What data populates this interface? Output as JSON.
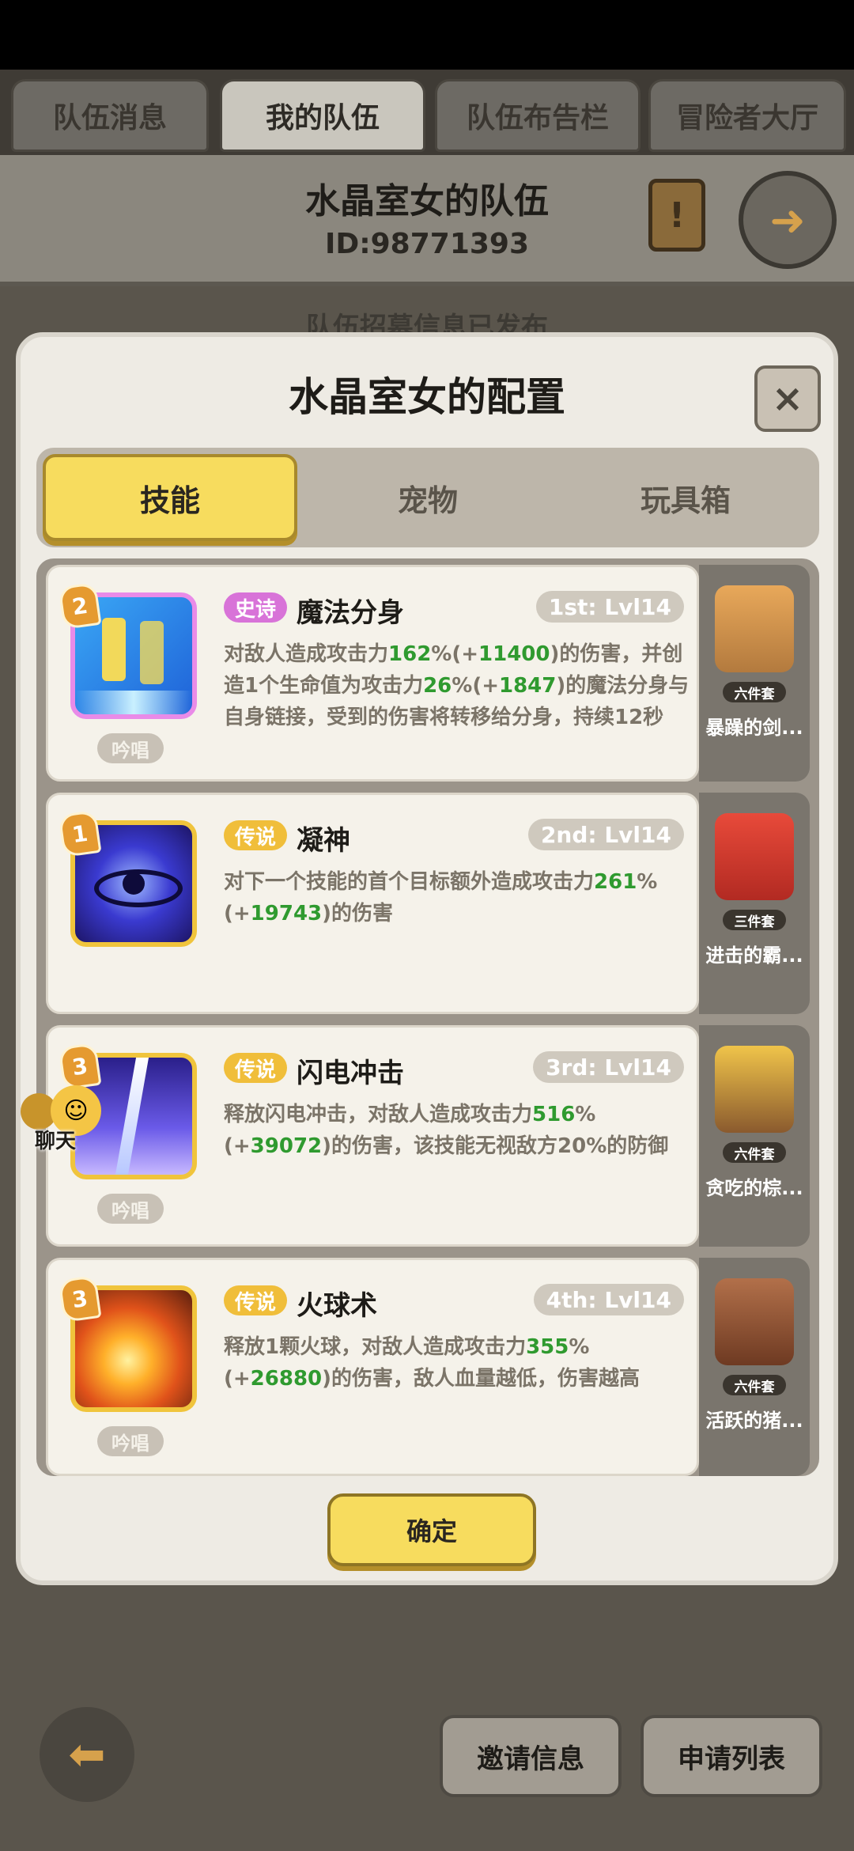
{
  "top_tabs": [
    {
      "label": "队伍消息"
    },
    {
      "label": "我的队伍"
    },
    {
      "label": "队伍布告栏"
    },
    {
      "label": "冒险者大厅"
    }
  ],
  "header": {
    "title": "水晶室女的队伍",
    "team_id": "ID:98771393"
  },
  "behind_text": "队伍招募信息已发布",
  "dialog": {
    "title": "水晶室女的配置",
    "close_label": "×",
    "tabs": [
      {
        "label": "技能"
      },
      {
        "label": "宠物"
      },
      {
        "label": "玩具箱"
      }
    ],
    "confirm_label": "确定"
  },
  "skills": [
    {
      "badge": "2",
      "rarity": "史诗",
      "name": "魔法分身",
      "level": "1st: Lvl14",
      "chant": "吟唱",
      "desc_parts": [
        "对敌人造成攻击力",
        "162",
        "%(+",
        "11400",
        ")的伤害，并创造1个生命值为攻击力",
        "26",
        "%(+",
        "1847",
        ")的魔法分身与自身链接，受到的伤害将转移给分身，持续12秒"
      ]
    },
    {
      "badge": "1",
      "rarity": "传说",
      "name": "凝神",
      "level": "2nd: Lvl14",
      "chant": "",
      "desc_parts": [
        "对下一个技能的首个目标额外造成攻击力",
        "261",
        "%(+",
        "19743",
        ")的伤害"
      ]
    },
    {
      "badge": "3",
      "rarity": "传说",
      "name": "闪电冲击",
      "level": "3rd: Lvl14",
      "chant": "吟唱",
      "desc_parts": [
        "释放闪电冲击，对敌人造成攻击力",
        "516",
        "%(+",
        "39072",
        ")的伤害，该技能无视敌方20%的防御"
      ]
    },
    {
      "badge": "3",
      "rarity": "传说",
      "name": "火球术",
      "level": "4th: Lvl14",
      "chant": "吟唱",
      "desc_parts": [
        "释放1颗火球，对敌人造成攻击力",
        "355",
        "%(+",
        "26880",
        ")的伤害，敌人血量越低，伤害越高"
      ]
    }
  ],
  "pets": [
    {
      "tag": "六件套",
      "name": "暴躁的剑..."
    },
    {
      "tag": "三件套",
      "name": "进击的霸..."
    },
    {
      "tag": "六件套",
      "name": "贪吃的棕..."
    },
    {
      "tag": "六件套",
      "name": "活跃的猪..."
    }
  ],
  "chat": {
    "label": "聊天"
  },
  "bottom": {
    "invite_label": "邀请信息",
    "apply_label": "申请列表"
  },
  "colors": {
    "accent_yellow": "#f7dc5e",
    "epic": "#d873d8",
    "legend": "#f0be3a",
    "highlight_green": "#2f9a2f"
  }
}
